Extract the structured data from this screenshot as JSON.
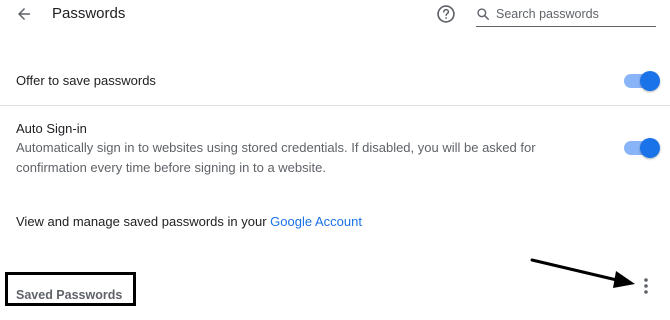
{
  "header": {
    "title": "Passwords",
    "back_icon": "arrow-back-icon",
    "help_icon": "help-circle-icon",
    "search": {
      "icon": "search-icon",
      "placeholder": "Search passwords",
      "value": ""
    }
  },
  "settings": {
    "offer_to_save": {
      "label": "Offer to save passwords",
      "enabled": true
    },
    "auto_signin": {
      "title": "Auto Sign-in",
      "description": "Automatically sign in to websites using stored credentials. If disabled, you will be asked for confirmation every time before signing in to a website.",
      "enabled": true
    },
    "manage": {
      "text": "View and manage saved passwords in your ",
      "link_label": "Google Account"
    }
  },
  "saved_passwords": {
    "heading": "Saved Passwords",
    "more_icon": "more-vert-icon"
  },
  "colors": {
    "accent": "#1a73e8",
    "toggle_track": "#8ab4f8",
    "secondary_text": "#5f6368",
    "annotation": "#000000"
  }
}
